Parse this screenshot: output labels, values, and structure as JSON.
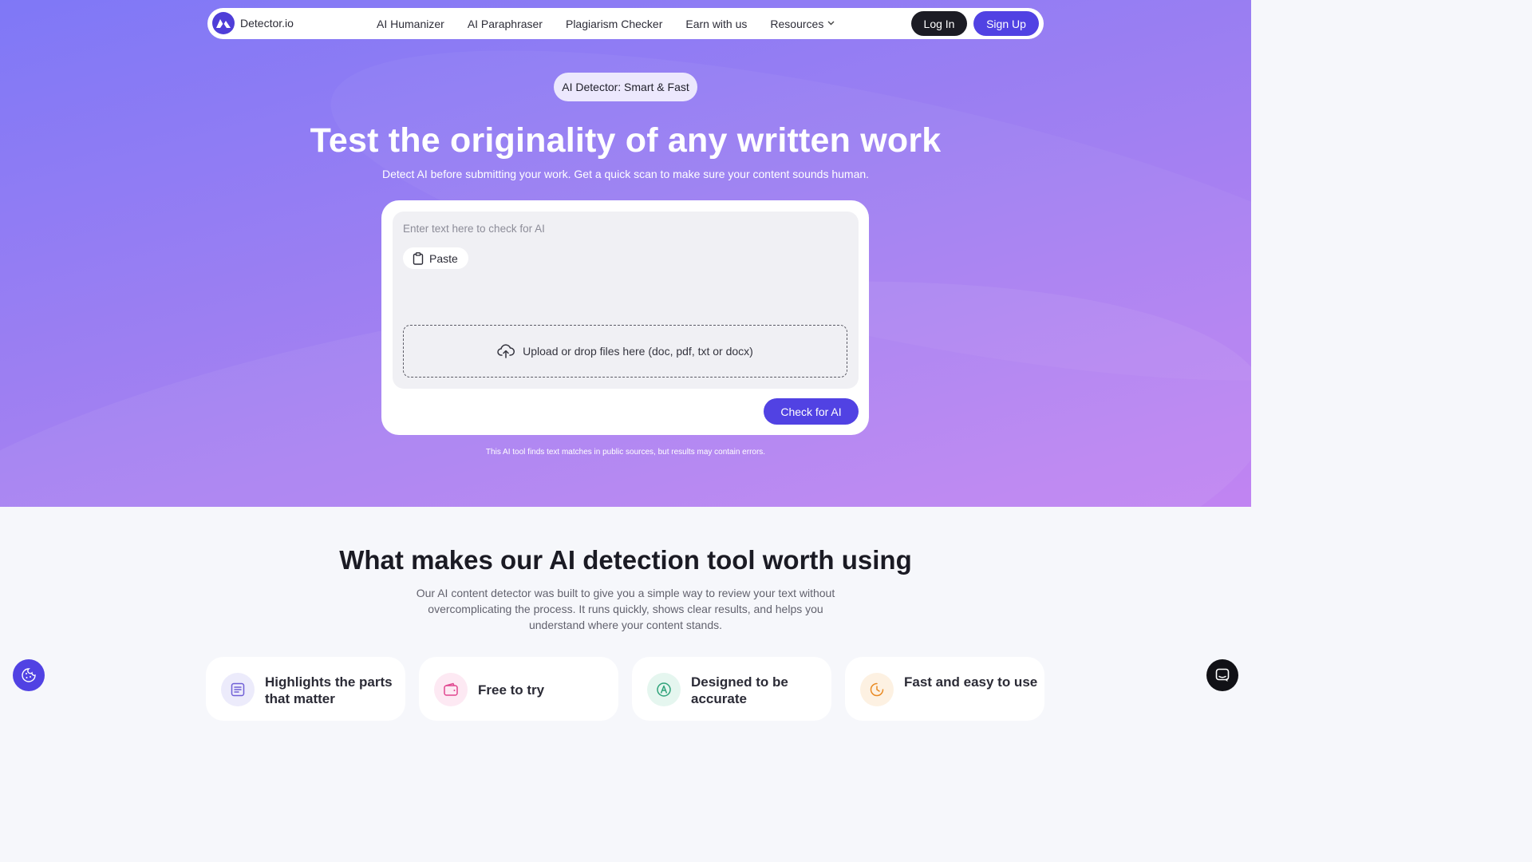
{
  "nav": {
    "brand": "Detector.io",
    "links": [
      "AI Humanizer",
      "AI Paraphraser",
      "Plagiarism Checker",
      "Earn with us",
      "Resources"
    ],
    "login": "Log In",
    "signup": "Sign Up"
  },
  "hero": {
    "pill": "AI Detector: Smart & Fast",
    "title": "Test the originality of any written work",
    "subtitle": "Detect AI before submitting your work. Get a quick scan to make sure your content sounds human."
  },
  "checker": {
    "placeholder": "Enter text here to check for AI",
    "paste": "Paste",
    "upload": "Upload or drop files here (doc, pdf, txt or docx)",
    "submit": "Check for AI",
    "disclaimer": "This AI tool finds text matches in public sources, but results may contain errors."
  },
  "features_section": {
    "title": "What makes our AI detection tool worth using",
    "description": "Our AI content detector was built to give you a simple way to review your text without overcomplicating the process. It runs quickly, shows clear results, and helps you understand where your content stands.",
    "cards": [
      {
        "title": "Highlights the parts that matter",
        "icon": "document-lines-icon",
        "color": "#6f5fd6",
        "bg": "#ecebfb"
      },
      {
        "title": "Free to try",
        "icon": "wallet-icon",
        "color": "#e0468f",
        "bg": "#fde9f3"
      },
      {
        "title": "Designed to be accurate",
        "icon": "compass-icon",
        "color": "#2fa37a",
        "bg": "#e5f6ef"
      },
      {
        "title": "Fast and easy to use",
        "icon": "clock-icon",
        "color": "#e98a23",
        "bg": "#fdf1e2"
      }
    ]
  },
  "colors": {
    "accent": "#5142e3",
    "dark": "#1c1c24"
  },
  "floating": {
    "cookie": "cookie-icon",
    "chat": "chat-icon"
  }
}
